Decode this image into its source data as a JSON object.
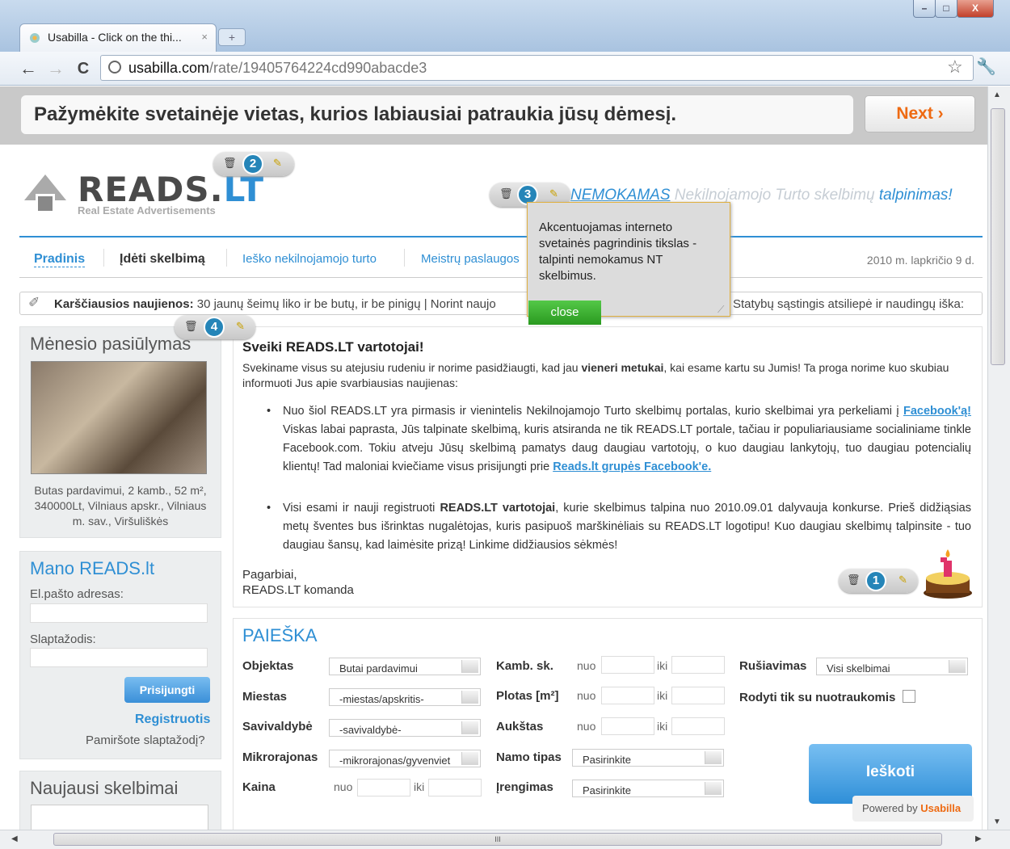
{
  "browser": {
    "tab_title": "Usabilla - Click on the thi...",
    "tab_close": "×",
    "new_tab": "+",
    "url_host": "usabilla.com",
    "url_path": "/rate/19405764224cd990abacde3",
    "back": "←",
    "forward": "→",
    "reload": "C",
    "star": "☆",
    "wrench": "🔧",
    "minimize": "–",
    "maximize": "□",
    "close": "X"
  },
  "usabilla": {
    "question": "Pažymėkite svetainėje vietas, kurios labiausiai patraukia jūsų dėmesį.",
    "next_label": "Next ›",
    "powered_prefix": "Powered by ",
    "powered_brand": "Usabilla",
    "markers": [
      {
        "num": "2"
      },
      {
        "num": "3"
      },
      {
        "num": "4"
      },
      {
        "num": "1"
      }
    ],
    "popup_text": "Akcentuojamas interneto svetainės pagrindinis tikslas - talpinti nemokamus NT skelbimus.",
    "popup_close": "close"
  },
  "site": {
    "logo_main": "READS.",
    "logo_lt": "LT",
    "logo_sub": "Real Estate Advertisements",
    "slogan_a": "NEMOKAMAS",
    "slogan_b": " Nekilnojamojo Turto skelbimų ",
    "slogan_c": "talpinimas!",
    "nav": [
      "Pradinis",
      "Įdėti skelbimą",
      "Ieško nekilnojamojo turto",
      "Meistrų paslaugos"
    ],
    "date": "2010 m. lapkričio 9 d.",
    "news_label": "Karščiausios naujienos:",
    "news_left": "30 jaunų šeimų liko ir be butų, ir be pinigų   |   Norint naujo",
    "news_right": "Statybų sąstingis atsiliepė ir naudingų iška:"
  },
  "offer": {
    "title": "Mėnesio pasiūlymas",
    "text": "Butas pardavimui, 2 kamb., 52 m², 340000Lt, Vilniaus apskr., Vilniaus m. sav., Viršuliškės"
  },
  "login": {
    "title": "Mano READS.lt",
    "email_label": "El.pašto adresas:",
    "password_label": "Slaptažodis:",
    "submit": "Prisijungti",
    "register": "Registruotis",
    "forgot": "Pamiršote slaptažodį?"
  },
  "latest": {
    "title": "Naujausi skelbimai"
  },
  "welcome": {
    "title": "Sveiki READS.LT vartotojai!",
    "intro_a": "Svekiname visus su atejusiu rudeniu ir norime pasidžiaugti, kad jau ",
    "intro_b": "vieneri metukai",
    "intro_c": ", kai esame kartu su Jumis! Ta proga norime kuo skubiau informuoti Jus apie svarbiausias naujienas:",
    "b1_a": "Nuo šiol READS.LT yra pirmasis ir vienintelis Nekilnojamojo Turto skelbimų portalas, kurio skelbimai yra perkeliami į ",
    "b1_link1": "Facebook'ą!",
    "b1_b": " Viskas labai paprasta, Jūs talpinate skelbimą, kuris atsiranda ne tik READS.LT portale, tačiau ir populiariausiame socialiniame tinkle Facebook.com. Tokiu atveju Jūsų skelbimą pamatys daug daugiau vartotojų, o kuo daugiau lankytojų, tuo daugiau potencialių klientų! Tad maloniai kviečiame visus prisijungti prie ",
    "b1_link2": "Reads.lt grupės Facebook'e.",
    "b2_a": "Visi esami ir nauji registruoti ",
    "b2_bold": "READS.LT vartotojai",
    "b2_b": ", kurie skelbimus talpina nuo 2010.09.01 dalyvauja konkurse. Prieš didžiąsias metų šventes bus išrinktas nugalėtojas, kuris pasipuoš marškinėliais su READS.LT logotipu! Kuo daugiau skelbimų talpinsite - tuo daugiau šansų, kad laimėsite prizą! Linkime didžiausios sėkmės!",
    "sign1": "Pagarbiai,",
    "sign2": "READS.LT komanda"
  },
  "search": {
    "title": "PAIEŠKA",
    "objektas": "Objektas",
    "objektas_val": "Butai pardavimui",
    "miestas": "Miestas",
    "miestas_val": "-miestas/apskritis-",
    "savivaldybe": "Savivaldybė",
    "savivaldybe_val": "-savivaldybė-",
    "mikro": "Mikrorajonas",
    "mikro_val": "-mikrorajonas/gyvenviet",
    "kaina": "Kaina",
    "kamb": "Kamb. sk.",
    "plotas": "Plotas [m²]",
    "aukstas": "Aukštas",
    "namo": "Namo tipas",
    "namo_val": "Pasirinkite",
    "irengimas": "Įrengimas",
    "irengimas_val": "Pasirinkite",
    "nuo": "nuo",
    "iki": "iki",
    "rusiavimas": "Rušiavimas",
    "rusiavimas_val": "Visi skelbimai",
    "rodyti": "Rodyti tik su nuotraukomis",
    "button": "Ieškoti"
  },
  "scrollbar_grip": "III"
}
